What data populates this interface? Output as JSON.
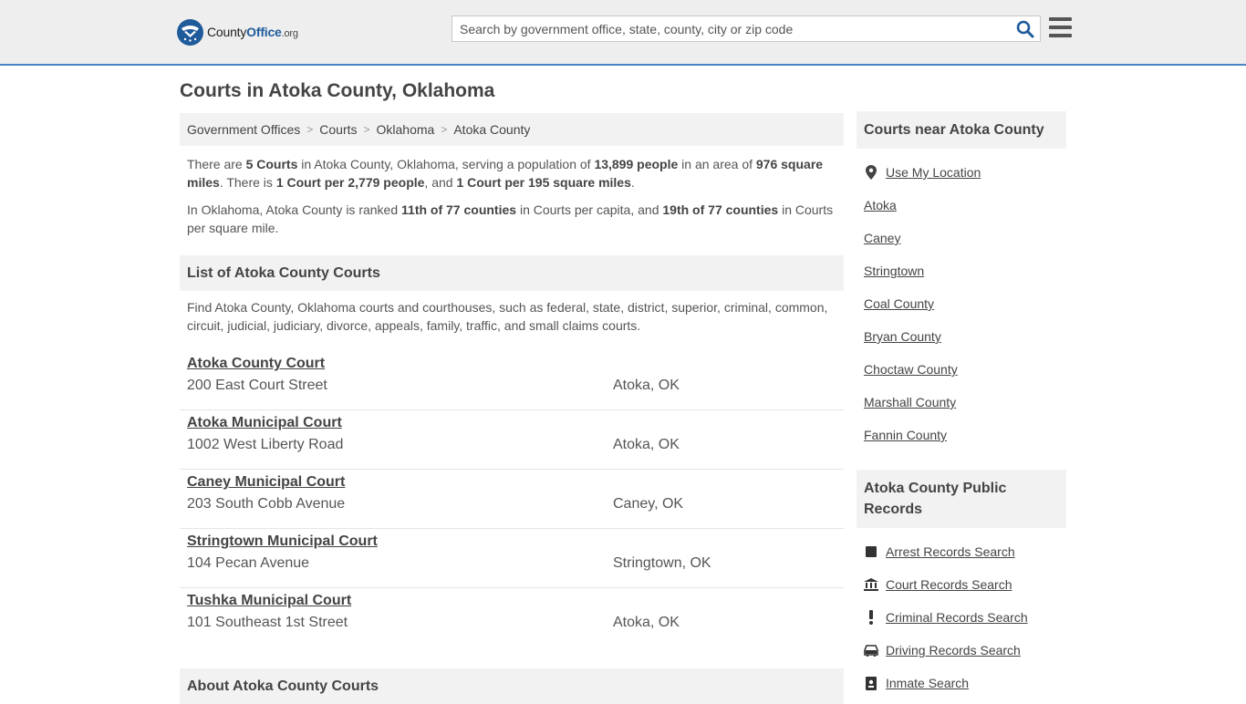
{
  "header": {
    "logo_county": "County",
    "logo_office": "Office",
    "logo_tld": ".org",
    "search_placeholder": "Search by government office, state, county, city or zip code"
  },
  "page_title": "Courts in Atoka County, Oklahoma",
  "breadcrumb": [
    "Government Offices",
    "Courts",
    "Oklahoma",
    "Atoka County"
  ],
  "summary": {
    "p1": {
      "t1": "There are ",
      "b1": "5 Courts",
      "t2": " in Atoka County, Oklahoma, serving a population of ",
      "b2": "13,899 people",
      "t3": " in an area of ",
      "b3": "976 square miles",
      "t4": ". There is ",
      "b4": "1 Court per 2,779 people",
      "t5": ", and ",
      "b5": "1 Court per 195 square miles",
      "t6": "."
    },
    "p2": {
      "t1": "In Oklahoma, Atoka County is ranked ",
      "b1": "11th of 77 counties",
      "t2": " in Courts per capita, and ",
      "b2": "19th of 77 counties",
      "t3": " in Courts per square mile."
    }
  },
  "list_section": {
    "title": "List of Atoka County Courts",
    "description": "Find Atoka County, Oklahoma courts and courthouses, such as federal, state, district, superior, criminal, common, circuit, judicial, judiciary, divorce, appeals, family, traffic, and small claims courts."
  },
  "courts": [
    {
      "name": "Atoka County Court",
      "address": "200 East Court Street",
      "city": "Atoka, OK"
    },
    {
      "name": "Atoka Municipal Court",
      "address": "1002 West Liberty Road",
      "city": "Atoka, OK"
    },
    {
      "name": "Caney Municipal Court",
      "address": "203 South Cobb Avenue",
      "city": "Caney, OK"
    },
    {
      "name": "Stringtown Municipal Court",
      "address": "104 Pecan Avenue",
      "city": "Stringtown, OK"
    },
    {
      "name": "Tushka Municipal Court",
      "address": "101 Southeast 1st Street",
      "city": "Atoka, OK"
    }
  ],
  "about_section": {
    "title": "About Atoka County Courts"
  },
  "sidebar": {
    "nearby_title": "Courts near Atoka County",
    "use_location": "Use My Location",
    "nearby": [
      "Atoka",
      "Caney",
      "Stringtown",
      "Coal County",
      "Bryan County",
      "Choctaw County",
      "Marshall County",
      "Fannin County"
    ],
    "records_title": "Atoka County Public Records",
    "records": [
      {
        "label": "Arrest Records Search",
        "icon": "square-icon"
      },
      {
        "label": "Court Records Search",
        "icon": "courthouse-icon"
      },
      {
        "label": "Criminal Records Search",
        "icon": "exclamation-icon"
      },
      {
        "label": "Driving Records Search",
        "icon": "car-icon"
      },
      {
        "label": "Inmate Search",
        "icon": "id-badge-icon"
      }
    ]
  },
  "colors": {
    "accent": "#4a84c4",
    "logo_blue": "#1f5a9b",
    "panel_bg": "#f2f2f2",
    "header_bg": "#eeeeee"
  }
}
